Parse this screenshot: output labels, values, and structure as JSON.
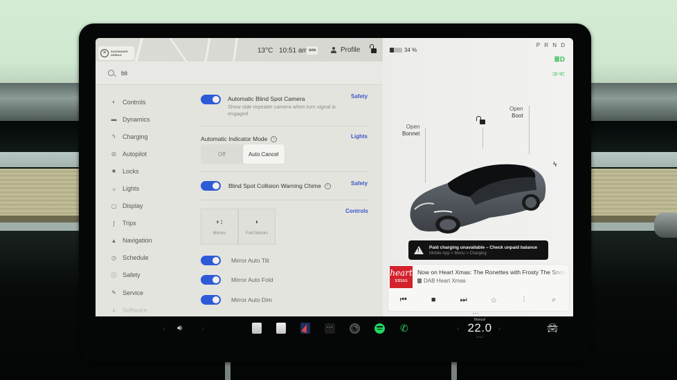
{
  "status_bar": {
    "airbag_label": "PASSENGER AIRBAG",
    "temperature": "13°C",
    "time": "10:51 am",
    "sos_label": "sos",
    "profile_label": "Profile",
    "lock_icon": "unlocked-icon"
  },
  "search": {
    "value": "bli",
    "icon": "search-icon"
  },
  "sidebar": {
    "items": [
      {
        "label": "Controls",
        "icon": "toggle-icon",
        "glyph": "◐"
      },
      {
        "label": "Dynamics",
        "icon": "car-icon",
        "glyph": "▬"
      },
      {
        "label": "Charging",
        "icon": "bolt-icon",
        "glyph": "ϟ"
      },
      {
        "label": "Autopilot",
        "icon": "steering-wheel-icon",
        "glyph": "◎"
      },
      {
        "label": "Locks",
        "icon": "lock-icon",
        "glyph": "■"
      },
      {
        "label": "Lights",
        "icon": "sun-icon",
        "glyph": "☼"
      },
      {
        "label": "Display",
        "icon": "display-icon",
        "glyph": "▢"
      },
      {
        "label": "Trips",
        "icon": "trips-icon",
        "glyph": "∫"
      },
      {
        "label": "Navigation",
        "icon": "navigation-arrow-icon",
        "glyph": "▲"
      },
      {
        "label": "Schedule",
        "icon": "clock-icon",
        "glyph": "◷"
      },
      {
        "label": "Safety",
        "icon": "info-circle-icon",
        "glyph": "ⓘ"
      },
      {
        "label": "Service",
        "icon": "wrench-icon",
        "glyph": "✎"
      },
      {
        "label": "Software",
        "icon": "download-icon",
        "glyph": "↓"
      }
    ]
  },
  "settings": {
    "blind_spot_camera": {
      "title": "Automatic Blind Spot Camera",
      "subtitle": "Show side repeater camera when turn signal is engaged",
      "category": "Safety",
      "enabled": true
    },
    "indicator_mode": {
      "title": "Automatic Indicator Mode",
      "category": "Lights",
      "options": [
        "Off",
        "Auto Cancel"
      ],
      "selected": "Auto Cancel"
    },
    "collision_chime": {
      "title": "Blind Spot Collision Warning Chime",
      "category": "Safety",
      "enabled": true
    },
    "mirrors_controls": {
      "category": "Controls",
      "buttons": [
        {
          "label": "Mirrors",
          "icon": "mirror-adjust-icon"
        },
        {
          "label": "Fold Mirrors",
          "icon": "mirror-fold-icon"
        }
      ]
    },
    "mirror_auto_tilt": {
      "title": "Mirror Auto Tilt",
      "enabled": true
    },
    "mirror_auto_fold": {
      "title": "Mirror Auto Fold",
      "enabled": true
    },
    "mirror_auto_dim": {
      "title": "Mirror Auto Dim",
      "enabled": true
    }
  },
  "car_panel": {
    "battery_percent_label": "34 %",
    "battery_level": 0.34,
    "gear": "P R N D",
    "open_bonnet": {
      "line1": "Open",
      "line2": "Bonnet"
    },
    "open_boot": {
      "line1": "Open",
      "line2": "Boot"
    },
    "colors": {
      "accent": "#3bbf5c",
      "toggle": "#2d5bd6",
      "link": "#3a56c5"
    }
  },
  "alert": {
    "title": "Paid charging unavailable – Check unpaid balance",
    "subtitle": "Mobile App > Menu > Charging"
  },
  "media": {
    "art_line1": "heart",
    "art_line2": "xmas",
    "title": "Now on Heart Xmas: The Ronettes with Frosty The Snowman",
    "station": "DAB Heart Xmas"
  },
  "dock": {
    "climate_mode": "Manual",
    "temperature": "22.0"
  }
}
